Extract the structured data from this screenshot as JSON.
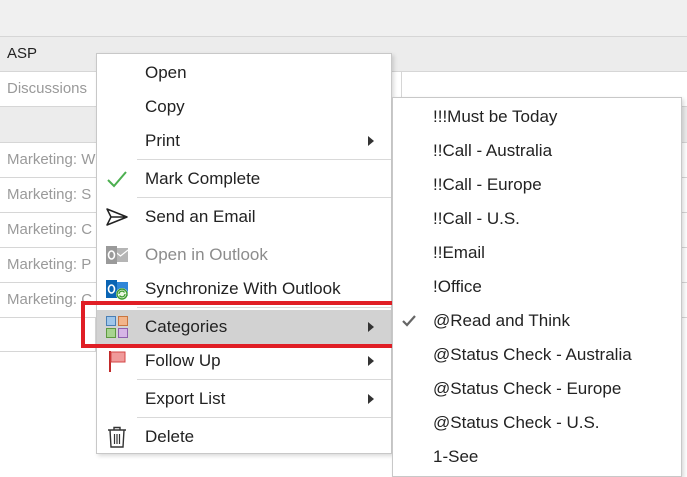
{
  "grid": {
    "rows": [
      {
        "text": "",
        "style": "header"
      },
      {
        "text": "ASP",
        "style": "group"
      },
      {
        "text": "Discussions",
        "style": "plain"
      },
      {
        "text": "",
        "style": "group"
      },
      {
        "text": "Marketing: W",
        "style": "plain"
      },
      {
        "text": "Marketing: S",
        "style": "plain"
      },
      {
        "text": "Marketing: C",
        "style": "plain"
      },
      {
        "text": "Marketing: P",
        "style": "plain"
      },
      {
        "text": "Marketing: C",
        "style": "plain"
      }
    ]
  },
  "context_menu": {
    "items": [
      {
        "label": "Open",
        "icon": "none",
        "submenu": false,
        "disabled": false
      },
      {
        "label": "Copy",
        "icon": "none",
        "submenu": false,
        "disabled": false
      },
      {
        "label": "Print",
        "icon": "none",
        "submenu": true,
        "disabled": false
      },
      {
        "label": "Mark Complete",
        "icon": "checkmark-icon",
        "submenu": false,
        "disabled": false
      },
      {
        "label": "Send an Email",
        "icon": "send-icon",
        "submenu": false,
        "disabled": false
      },
      {
        "label": "Open in Outlook",
        "icon": "outlook-open-icon",
        "submenu": false,
        "disabled": true
      },
      {
        "label": "Synchronize With Outlook",
        "icon": "outlook-sync-icon",
        "submenu": false,
        "disabled": false
      },
      {
        "label": "Categories",
        "icon": "categories-icon",
        "submenu": true,
        "disabled": false,
        "highlighted": true
      },
      {
        "label": "Follow Up",
        "icon": "flag-icon",
        "submenu": true,
        "disabled": false
      },
      {
        "label": "Export List",
        "icon": "none",
        "submenu": true,
        "disabled": false
      },
      {
        "label": "Delete",
        "icon": "trash-icon",
        "submenu": false,
        "disabled": false
      }
    ]
  },
  "categories_submenu": {
    "items": [
      {
        "label": "!!!Must be Today",
        "checked": false
      },
      {
        "label": "!!Call - Australia",
        "checked": false
      },
      {
        "label": "!!Call - Europe",
        "checked": false
      },
      {
        "label": "!!Call - U.S.",
        "checked": false
      },
      {
        "label": "!!Email",
        "checked": false
      },
      {
        "label": "!Office",
        "checked": false
      },
      {
        "label": "@Read and Think",
        "checked": true
      },
      {
        "label": "@Status Check - Australia",
        "checked": false
      },
      {
        "label": "@Status Check - Europe",
        "checked": false
      },
      {
        "label": "@Status Check - U.S.",
        "checked": false
      },
      {
        "label": "1-See",
        "checked": false
      }
    ]
  },
  "colors": {
    "highlight": "#d2d2d2",
    "annotation": "#e01e25",
    "check_green": "#4caf50",
    "outlook_blue": "#0a64b4",
    "flag_red": "#e03a3a"
  }
}
